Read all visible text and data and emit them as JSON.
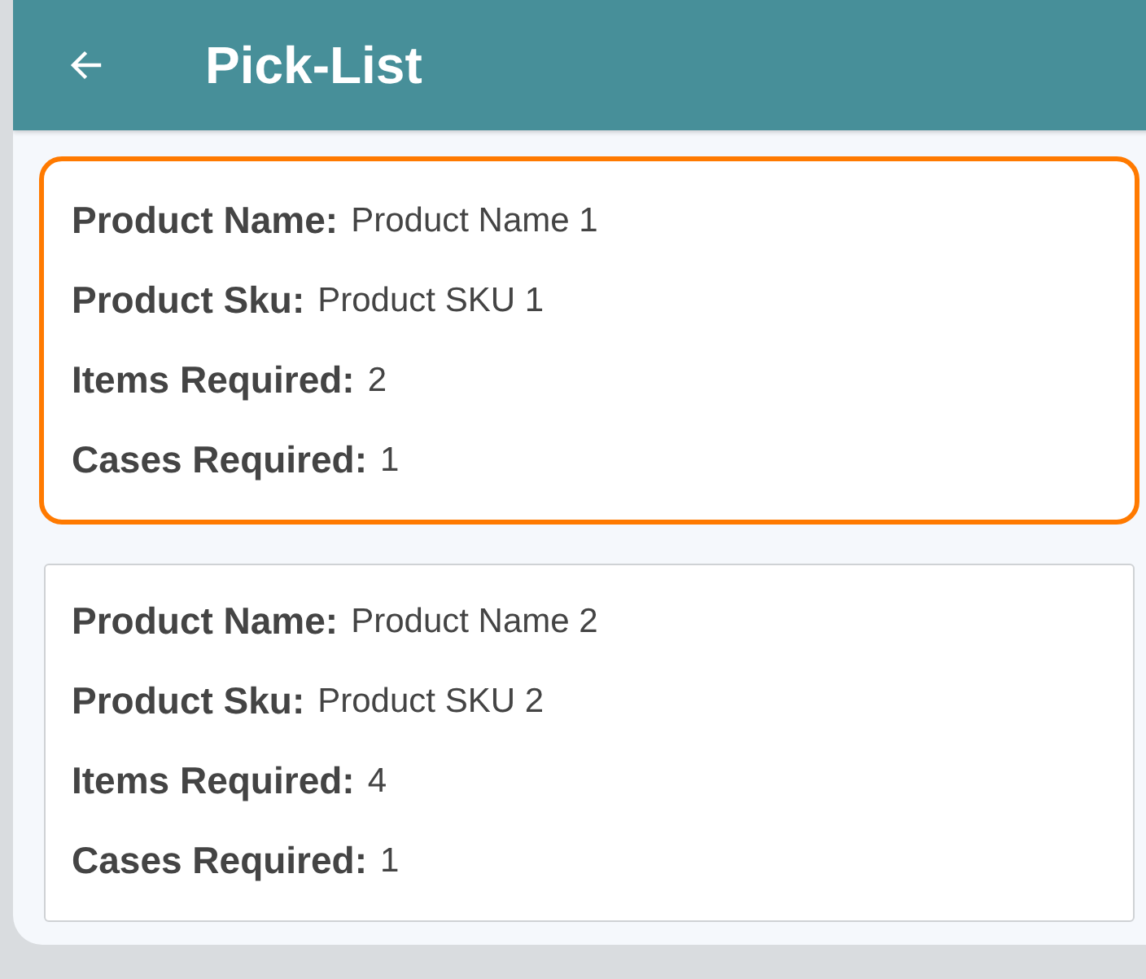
{
  "header": {
    "title": "Pick-List"
  },
  "items": [
    {
      "selected": true,
      "fields": [
        {
          "label": "Product Name:",
          "value": "Product Name 1"
        },
        {
          "label": "Product Sku:",
          "value": "Product SKU 1"
        },
        {
          "label": "Items Required:",
          "value": "2"
        },
        {
          "label": "Cases Required:",
          "value": "1"
        }
      ]
    },
    {
      "selected": false,
      "fields": [
        {
          "label": "Product Name:",
          "value": "Product Name 2"
        },
        {
          "label": "Product Sku:",
          "value": "Product SKU 2"
        },
        {
          "label": "Items Required:",
          "value": "4"
        },
        {
          "label": "Cases Required:",
          "value": "1"
        }
      ]
    }
  ]
}
